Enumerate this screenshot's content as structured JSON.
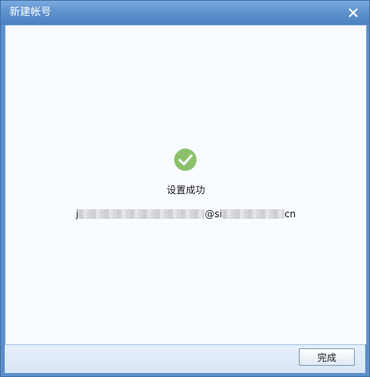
{
  "window": {
    "title": "新建帐号",
    "close_icon": "close-icon"
  },
  "content": {
    "status_icon": "check-circle-icon",
    "status_color": "#8cc16b",
    "status_text": "设置成功",
    "email": {
      "prefix": "j",
      "middle": "@si",
      "suffix": "cn"
    }
  },
  "footer": {
    "done_label": "完成"
  }
}
